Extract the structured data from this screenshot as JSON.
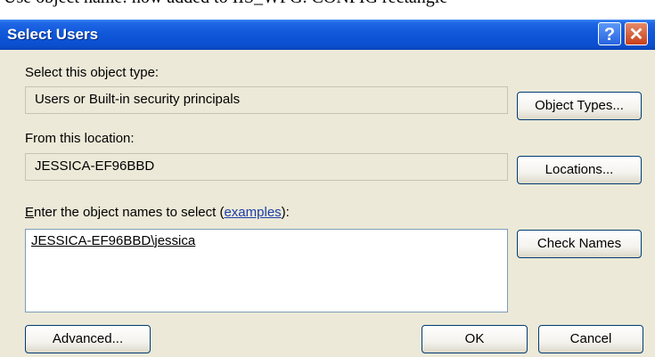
{
  "background_text": "Use object name: now added to IIS_WPG. CONFIG rectangle",
  "window": {
    "title": "Select Users"
  },
  "titlebar": {
    "help_glyph": "?",
    "close_glyph": "✕"
  },
  "object_type": {
    "label": "Select this object type:",
    "value": "Users or Built-in security principals",
    "button": "Object Types..."
  },
  "location": {
    "label": "From this location:",
    "value": "JESSICA-EF96BBD",
    "button": "Locations..."
  },
  "names": {
    "label_prefix_u": "E",
    "label_rest": "nter the object names to select (",
    "link": "examples",
    "label_suffix": "):",
    "value": "JESSICA-EF96BBD\\jessica",
    "check_button": "Check Names"
  },
  "footer": {
    "advanced_button": "Advanced...",
    "ok_button": "OK",
    "cancel_button": "Cancel"
  },
  "colors": {
    "titlebar": "#0b4fd0",
    "dialog_bg": "#ece9d8",
    "link": "#1d3ea8"
  }
}
